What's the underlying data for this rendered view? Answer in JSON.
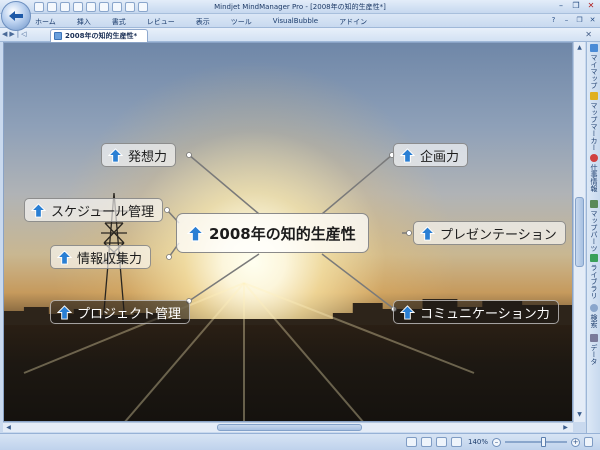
{
  "window": {
    "title": "Mindjet MindManager Pro - [2008年の知的生産性*]"
  },
  "ribbon": {
    "tabs": [
      "ホーム",
      "挿入",
      "書式",
      "レビュー",
      "表示",
      "ツール",
      "VisualBubble",
      "アドイン"
    ]
  },
  "document": {
    "tab_label": "2008年の知的生産性*"
  },
  "map": {
    "central_topic": "2008年の知的生産性",
    "topics": {
      "hassou": "発想力",
      "kikaku": "企画力",
      "schedule": "スケジュール管理",
      "presentation": "プレゼンテーション",
      "joho": "情報収集力",
      "project": "プロジェクト管理",
      "communication": "コミュニケーション力"
    }
  },
  "task_pane": {
    "items": [
      "マイマップ",
      "マップマーカー",
      "仕事情報",
      "マップパーツ",
      "ライブラリ",
      "検索",
      "データ"
    ]
  },
  "status": {
    "zoom": "140%"
  },
  "colors": {
    "ribbon": "#c8d9ef",
    "topic_arrow": "#2a7fd4"
  }
}
